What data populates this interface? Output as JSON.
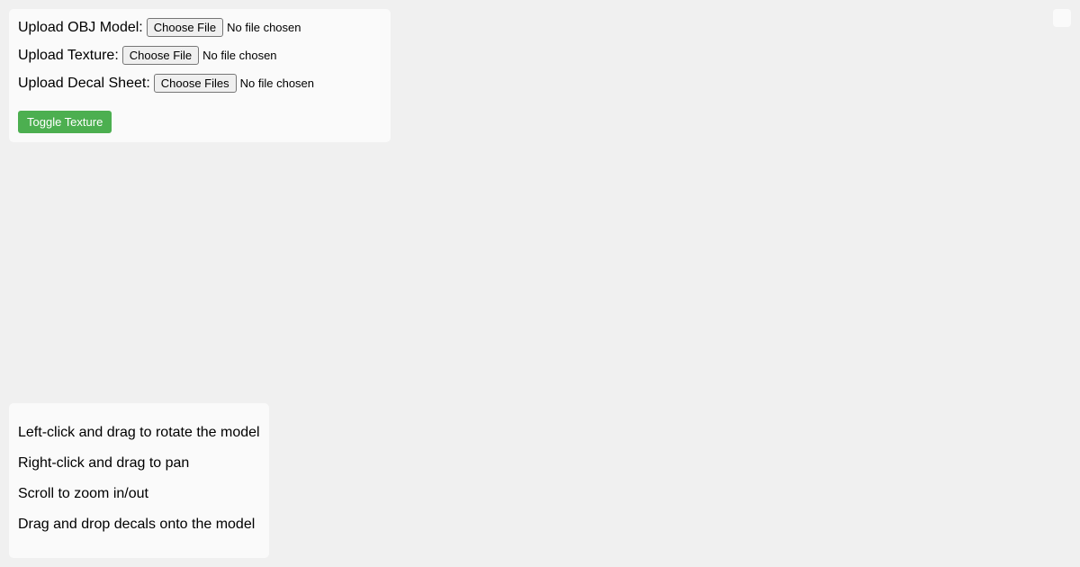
{
  "upload_panel": {
    "rows": [
      {
        "label": "Upload OBJ Model:",
        "button": "Choose File",
        "status": "No file chosen"
      },
      {
        "label": "Upload Texture:",
        "button": "Choose File",
        "status": "No file chosen"
      },
      {
        "label": "Upload Decal Sheet:",
        "button": "Choose Files",
        "status": "No file chosen"
      }
    ],
    "toggle_texture_label": "Toggle Texture",
    "accent_color": "#4caf50"
  },
  "help_panel": {
    "instructions": [
      "Left-click and drag to rotate the model",
      "Right-click and drag to pan",
      "Scroll to zoom in/out",
      "Drag and drop decals onto the model"
    ]
  }
}
